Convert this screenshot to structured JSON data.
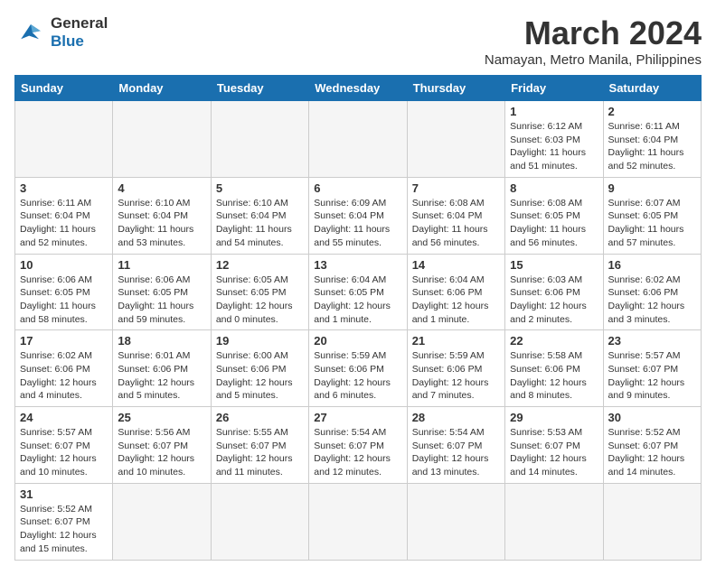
{
  "header": {
    "title": "March 2024",
    "subtitle": "Namayan, Metro Manila, Philippines",
    "logo_line1": "General",
    "logo_line2": "Blue"
  },
  "weekdays": [
    "Sunday",
    "Monday",
    "Tuesday",
    "Wednesday",
    "Thursday",
    "Friday",
    "Saturday"
  ],
  "weeks": [
    [
      {
        "day": "",
        "info": ""
      },
      {
        "day": "",
        "info": ""
      },
      {
        "day": "",
        "info": ""
      },
      {
        "day": "",
        "info": ""
      },
      {
        "day": "",
        "info": ""
      },
      {
        "day": "1",
        "info": "Sunrise: 6:12 AM\nSunset: 6:03 PM\nDaylight: 11 hours\nand 51 minutes."
      },
      {
        "day": "2",
        "info": "Sunrise: 6:11 AM\nSunset: 6:04 PM\nDaylight: 11 hours\nand 52 minutes."
      }
    ],
    [
      {
        "day": "3",
        "info": "Sunrise: 6:11 AM\nSunset: 6:04 PM\nDaylight: 11 hours\nand 52 minutes."
      },
      {
        "day": "4",
        "info": "Sunrise: 6:10 AM\nSunset: 6:04 PM\nDaylight: 11 hours\nand 53 minutes."
      },
      {
        "day": "5",
        "info": "Sunrise: 6:10 AM\nSunset: 6:04 PM\nDaylight: 11 hours\nand 54 minutes."
      },
      {
        "day": "6",
        "info": "Sunrise: 6:09 AM\nSunset: 6:04 PM\nDaylight: 11 hours\nand 55 minutes."
      },
      {
        "day": "7",
        "info": "Sunrise: 6:08 AM\nSunset: 6:04 PM\nDaylight: 11 hours\nand 56 minutes."
      },
      {
        "day": "8",
        "info": "Sunrise: 6:08 AM\nSunset: 6:05 PM\nDaylight: 11 hours\nand 56 minutes."
      },
      {
        "day": "9",
        "info": "Sunrise: 6:07 AM\nSunset: 6:05 PM\nDaylight: 11 hours\nand 57 minutes."
      }
    ],
    [
      {
        "day": "10",
        "info": "Sunrise: 6:06 AM\nSunset: 6:05 PM\nDaylight: 11 hours\nand 58 minutes."
      },
      {
        "day": "11",
        "info": "Sunrise: 6:06 AM\nSunset: 6:05 PM\nDaylight: 11 hours\nand 59 minutes."
      },
      {
        "day": "12",
        "info": "Sunrise: 6:05 AM\nSunset: 6:05 PM\nDaylight: 12 hours\nand 0 minutes."
      },
      {
        "day": "13",
        "info": "Sunrise: 6:04 AM\nSunset: 6:05 PM\nDaylight: 12 hours\nand 1 minute."
      },
      {
        "day": "14",
        "info": "Sunrise: 6:04 AM\nSunset: 6:06 PM\nDaylight: 12 hours\nand 1 minute."
      },
      {
        "day": "15",
        "info": "Sunrise: 6:03 AM\nSunset: 6:06 PM\nDaylight: 12 hours\nand 2 minutes."
      },
      {
        "day": "16",
        "info": "Sunrise: 6:02 AM\nSunset: 6:06 PM\nDaylight: 12 hours\nand 3 minutes."
      }
    ],
    [
      {
        "day": "17",
        "info": "Sunrise: 6:02 AM\nSunset: 6:06 PM\nDaylight: 12 hours\nand 4 minutes."
      },
      {
        "day": "18",
        "info": "Sunrise: 6:01 AM\nSunset: 6:06 PM\nDaylight: 12 hours\nand 5 minutes."
      },
      {
        "day": "19",
        "info": "Sunrise: 6:00 AM\nSunset: 6:06 PM\nDaylight: 12 hours\nand 5 minutes."
      },
      {
        "day": "20",
        "info": "Sunrise: 5:59 AM\nSunset: 6:06 PM\nDaylight: 12 hours\nand 6 minutes."
      },
      {
        "day": "21",
        "info": "Sunrise: 5:59 AM\nSunset: 6:06 PM\nDaylight: 12 hours\nand 7 minutes."
      },
      {
        "day": "22",
        "info": "Sunrise: 5:58 AM\nSunset: 6:06 PM\nDaylight: 12 hours\nand 8 minutes."
      },
      {
        "day": "23",
        "info": "Sunrise: 5:57 AM\nSunset: 6:07 PM\nDaylight: 12 hours\nand 9 minutes."
      }
    ],
    [
      {
        "day": "24",
        "info": "Sunrise: 5:57 AM\nSunset: 6:07 PM\nDaylight: 12 hours\nand 10 minutes."
      },
      {
        "day": "25",
        "info": "Sunrise: 5:56 AM\nSunset: 6:07 PM\nDaylight: 12 hours\nand 10 minutes."
      },
      {
        "day": "26",
        "info": "Sunrise: 5:55 AM\nSunset: 6:07 PM\nDaylight: 12 hours\nand 11 minutes."
      },
      {
        "day": "27",
        "info": "Sunrise: 5:54 AM\nSunset: 6:07 PM\nDaylight: 12 hours\nand 12 minutes."
      },
      {
        "day": "28",
        "info": "Sunrise: 5:54 AM\nSunset: 6:07 PM\nDaylight: 12 hours\nand 13 minutes."
      },
      {
        "day": "29",
        "info": "Sunrise: 5:53 AM\nSunset: 6:07 PM\nDaylight: 12 hours\nand 14 minutes."
      },
      {
        "day": "30",
        "info": "Sunrise: 5:52 AM\nSunset: 6:07 PM\nDaylight: 12 hours\nand 14 minutes."
      }
    ],
    [
      {
        "day": "31",
        "info": "Sunrise: 5:52 AM\nSunset: 6:07 PM\nDaylight: 12 hours\nand 15 minutes."
      },
      {
        "day": "",
        "info": ""
      },
      {
        "day": "",
        "info": ""
      },
      {
        "day": "",
        "info": ""
      },
      {
        "day": "",
        "info": ""
      },
      {
        "day": "",
        "info": ""
      },
      {
        "day": "",
        "info": ""
      }
    ]
  ]
}
